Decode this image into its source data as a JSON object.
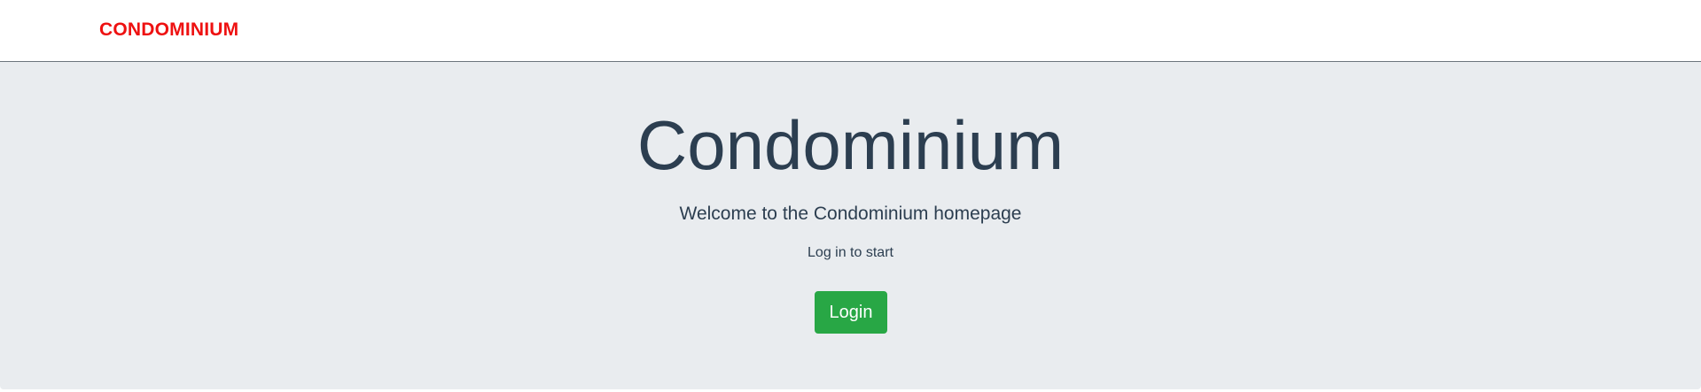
{
  "navbar": {
    "brand": "CONDOMINIUM"
  },
  "hero": {
    "title": "Condominium",
    "lead": "Welcome to the Condominium homepage",
    "subtext": "Log in to start",
    "login_label": "Login"
  },
  "colors": {
    "brand": "#ee1111",
    "hero_background": "#e9ecef",
    "text": "#2c3e50",
    "button": "#28a745"
  }
}
